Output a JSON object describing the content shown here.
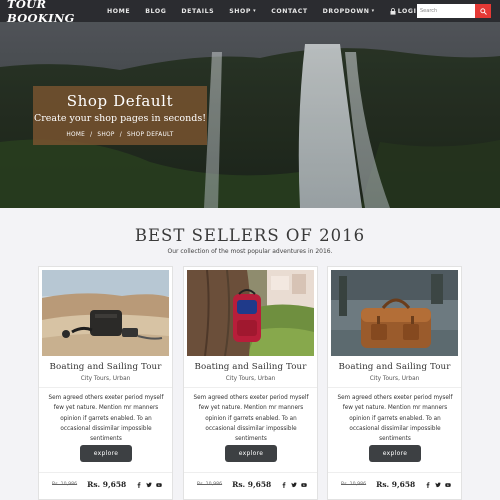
{
  "brand": "TOUR BOOKING",
  "nav": {
    "items": [
      "HOME",
      "BLOG",
      "DETAILS",
      "SHOP",
      "CONTACT",
      "DROPDOWN",
      "LOGIN"
    ],
    "search_placeholder": "Search"
  },
  "hero": {
    "title": "Shop Default",
    "subtitle": "Create your shop pages in seconds!",
    "breadcrumb": [
      "HOME",
      "/",
      "SHOP",
      "/",
      "SHOP DEFAULT"
    ]
  },
  "section": {
    "title": "BEST SELLERS OF 2016",
    "subtitle": "Our collection of the most popular adventures in 2016."
  },
  "cards": [
    {
      "title": "Boating and Sailing Tour",
      "category": "City Tours,  Urban",
      "description": "Sem agreed others exeter period myself few yet nature. Mention mr manners opinion if garrets enabled. To an occasional dissimilar impossible sentiments",
      "button": "explore",
      "old_price": "Rs. 10,986",
      "price": "Rs. 9,658"
    },
    {
      "title": "Boating and Sailing Tour",
      "category": "City Tours,  Urban",
      "description": "Sem agreed others exeter period myself few yet nature. Mention mr manners opinion if garrets enabled. To an occasional dissimilar impossible sentiments",
      "button": "explore",
      "old_price": "Rs. 10,986",
      "price": "Rs. 9,658"
    },
    {
      "title": "Boating and Sailing Tour",
      "category": "City Tours,  Urban",
      "description": "Sem agreed others exeter period myself few yet nature. Mention mr manners opinion if garrets enabled. To an occasional dissimilar impossible sentiments",
      "button": "explore",
      "old_price": "Rs. 10,986",
      "price": "Rs. 9,658"
    }
  ],
  "icons": [
    "search-icon",
    "lock-icon",
    "facebook-icon",
    "twitter-icon",
    "youtube-icon"
  ],
  "colors": {
    "navbar": "#2b2c30",
    "search_button": "#e53935",
    "hero_box": "#7a5430",
    "explore_button": "#3d4043",
    "page_bg": "#f3f3f6"
  }
}
